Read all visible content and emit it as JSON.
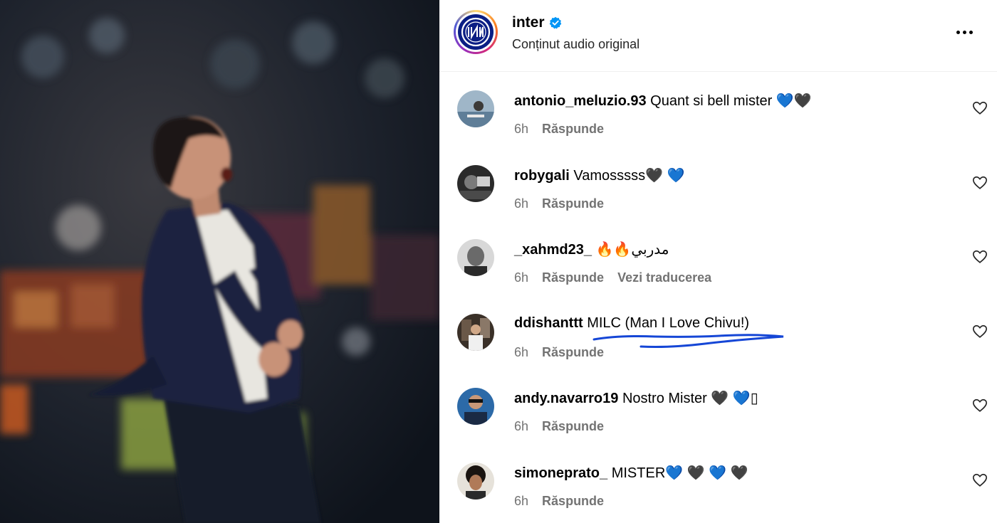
{
  "header": {
    "username": "inter",
    "subtitle": "Conținut audio original"
  },
  "icons": {
    "verified": "verified-badge-icon",
    "more": "more-options-icon",
    "like": "heart-icon"
  },
  "colors": {
    "verified": "#0095f6",
    "meta_text": "#737373",
    "annotation_underline": "#1546d6",
    "inter_blue": "#0a1e84"
  },
  "comments": [
    {
      "user": "antonio_meluzio.93",
      "text": "Quant si bell mister 💙🖤",
      "time": "6h",
      "reply": "Răspunde"
    },
    {
      "user": "robygali",
      "text": "Vamosssss🖤 💙",
      "time": "6h",
      "reply": "Răspunde"
    },
    {
      "user": "_xahmd23_",
      "text": "🔥🔥مدربي",
      "time": "6h",
      "reply": "Răspunde",
      "translate": "Vezi traducerea"
    },
    {
      "user": "ddishanttt",
      "text": "MILC (Man I Love Chivu!)",
      "time": "6h",
      "reply": "Răspunde"
    },
    {
      "user": "andy.navarro19",
      "text": "Nostro Mister 🖤 💙▯",
      "time": "6h",
      "reply": "Răspunde"
    },
    {
      "user": "simoneprato_",
      "text": "MISTER💙 🖤 💙 🖤",
      "time": "6h",
      "reply": "Răspunde"
    }
  ]
}
